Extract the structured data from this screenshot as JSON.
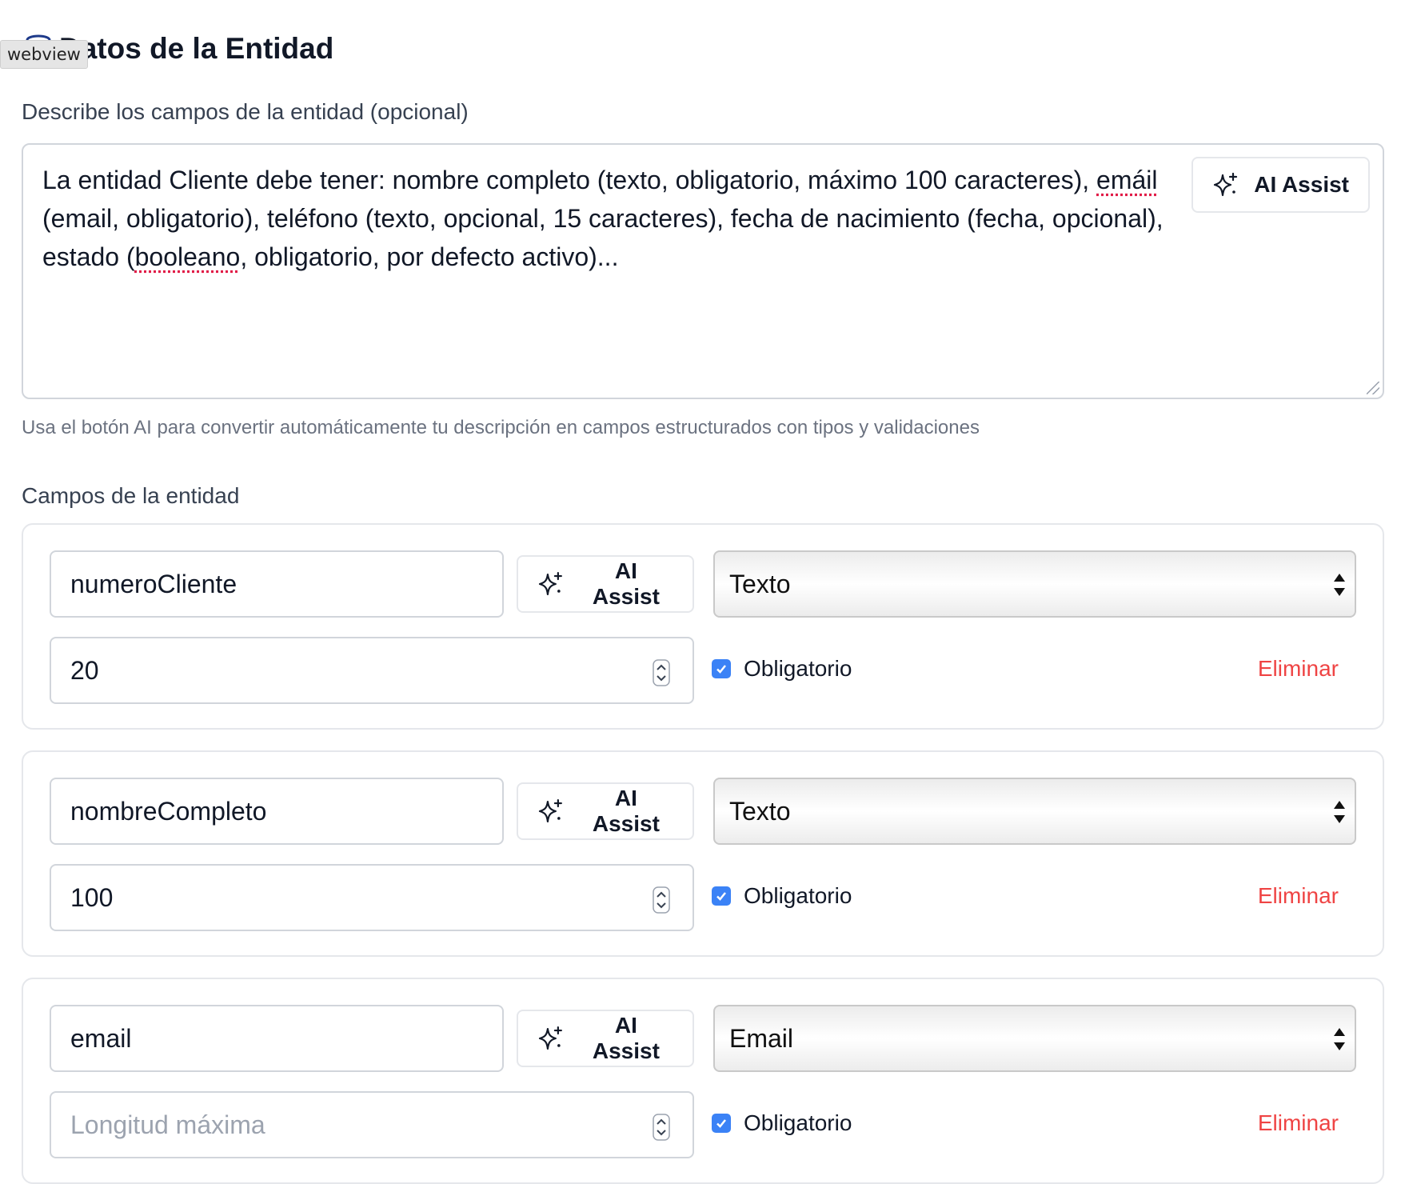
{
  "tooltip": "webview",
  "section_title": "Datos de la Entidad",
  "description": {
    "label": "Describe los campos de la entidad (opcional)",
    "text_parts": [
      "La entidad Cliente debe tener: nombre completo (texto, obligatorio, máximo 100 caracteres), ",
      "emáil",
      " (email, obligatorio), teléfono (texto, opcional, 15 caracteres), fecha de nacimiento (fecha, opcional), estado (",
      "booleano",
      ", obligatorio, por defecto activo)..."
    ],
    "ai_button": "AI Assist",
    "hint": "Usa el botón AI para convertir automáticamente tu descripción en campos estructurados con tipos y validaciones"
  },
  "fields_label": "Campos de la entidad",
  "fields": [
    {
      "name": "numeroCliente",
      "ai_button": "AI Assist",
      "type": "Texto",
      "max_length": "20",
      "max_length_placeholder": "Longitud máxima",
      "required_label": "Obligatorio",
      "required": true,
      "delete_label": "Eliminar"
    },
    {
      "name": "nombreCompleto",
      "ai_button": "AI Assist",
      "type": "Texto",
      "max_length": "100",
      "max_length_placeholder": "Longitud máxima",
      "required_label": "Obligatorio",
      "required": true,
      "delete_label": "Eliminar"
    },
    {
      "name": "email",
      "ai_button": "AI Assist",
      "type": "Email",
      "max_length": "",
      "max_length_placeholder": "Longitud máxima",
      "required_label": "Obligatorio",
      "required": true,
      "delete_label": "Eliminar"
    }
  ],
  "colors": {
    "accent": "#3b82f6",
    "danger": "#ef4444",
    "border": "#d1d5db"
  },
  "icons": {
    "header": "database-icon",
    "ai": "sparkles-icon",
    "select": "select-arrows-icon",
    "spinner": "number-spinner-icon",
    "check": "check-icon"
  }
}
